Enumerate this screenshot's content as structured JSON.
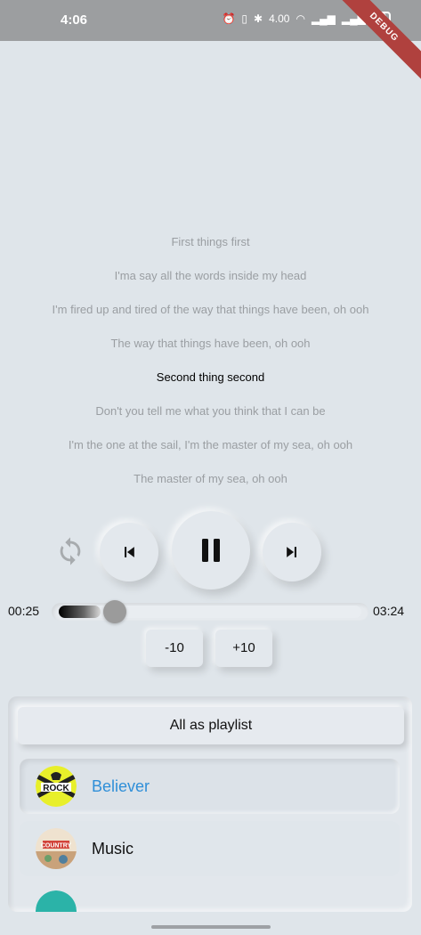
{
  "status_bar": {
    "time": "4:06",
    "net_speed": "4.00",
    "battery": "60",
    "debug_label": "DEBUG"
  },
  "lyrics": [
    {
      "text": "First things first",
      "active": false
    },
    {
      "text": "I'ma say all the words inside my head",
      "active": false
    },
    {
      "text": "I'm fired up and tired of the way that things have been, oh ooh",
      "active": false
    },
    {
      "text": "The way that things have been, oh ooh",
      "active": false
    },
    {
      "text": "Second thing second",
      "active": true
    },
    {
      "text": "Don't you tell me what you think that I can be",
      "active": false
    },
    {
      "text": "I'm the one at the sail, I'm the master of my sea, oh ooh",
      "active": false
    },
    {
      "text": "The master of my sea, oh ooh",
      "active": false
    }
  ],
  "controls": {
    "repeat_icon": "repeat-icon",
    "prev_icon": "skip-previous-icon",
    "play_state_icon": "pause-icon",
    "next_icon": "skip-next-icon"
  },
  "progress": {
    "current": "00:25",
    "total": "03:24",
    "fraction": 0.122
  },
  "skip": {
    "back_label": "-10",
    "forward_label": "+10"
  },
  "playlist": {
    "all_label": "All as playlist",
    "songs": [
      {
        "title": "Believer",
        "cover": "rock-cover",
        "selected": true
      },
      {
        "title": "Music",
        "cover": "country-cover",
        "selected": false
      },
      {
        "title": "",
        "cover": "teal-cover",
        "selected": false
      }
    ]
  },
  "colors": {
    "background": "#dfe5ea",
    "selected_song": "#2f8fd8",
    "status_bar": "#9c9ea0",
    "debug_ribbon": "#b0413e"
  }
}
